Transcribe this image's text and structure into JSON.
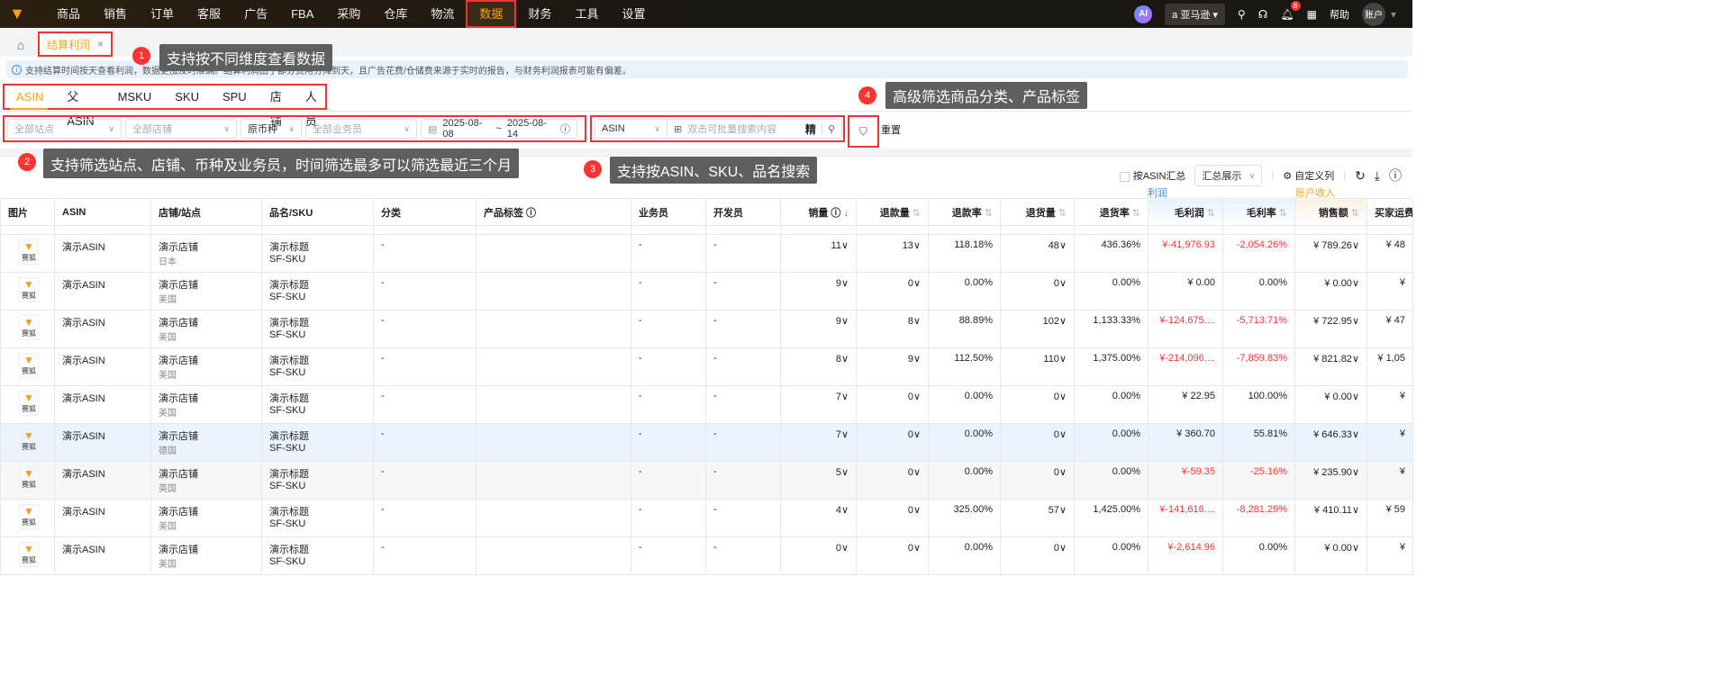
{
  "nav": {
    "items": [
      "商品",
      "销售",
      "订单",
      "客服",
      "广告",
      "FBA",
      "采购",
      "仓库",
      "物流",
      "数据",
      "财务",
      "工具",
      "设置"
    ],
    "active": "数据",
    "ai": "AI",
    "marketplace": "亚马逊",
    "notifications": "8",
    "help": "帮助",
    "account": "账户"
  },
  "page_tab": "结算利润",
  "info": "支持结算时间按天查看利润，数据更加及时准确。结算利润由于部分费用分摊到天，且广告花费/仓储费来源于实时的报告，与财务利润报表可能有偏差。",
  "dim_tabs": [
    "ASIN",
    "父ASIN",
    "MSKU",
    "SKU",
    "SPU",
    "店铺",
    "人员"
  ],
  "filters": {
    "site": "全部站点",
    "store": "全部店铺",
    "currency": "原币种",
    "salesperson": "全部业务员",
    "date_start": "2025-08-08",
    "date_sep": "~",
    "date_end": "2025-08-14",
    "search_type": "ASIN",
    "search_placeholder": "双击可批量搜索内容",
    "exact": "精",
    "reset": "重置"
  },
  "callouts": [
    {
      "num": "1",
      "text": "支持按不同维度查看数据"
    },
    {
      "num": "2",
      "text": "支持筛选站点、店铺、币种及业务员，时间筛选最多可以筛选最近三个月"
    },
    {
      "num": "3",
      "text": "支持按ASIN、SKU、品名搜索"
    },
    {
      "num": "4",
      "text": "高级筛选商品分类、产品标签"
    }
  ],
  "tools": {
    "group_by_asin": "按ASIN汇总",
    "summary_mode": "汇总展示",
    "custom_columns": "自定义列"
  },
  "groups": {
    "profit": "利润",
    "income": "账户收入"
  },
  "columns": [
    "图片",
    "ASIN",
    "店铺/站点",
    "品名/SKU",
    "分类",
    "产品标签",
    "业务员",
    "开发员",
    "销量",
    "退款量",
    "退款率",
    "退货量",
    "退货率",
    "毛利润",
    "毛利率",
    "销售额",
    "买家运费"
  ],
  "thumb_label": "赛狐",
  "rows": [
    [
      "演示ASIN",
      "演示店铺",
      "日本",
      "演示标题",
      "SF-SKU",
      "-",
      "",
      "-",
      "-",
      "11",
      "13",
      "118.18%",
      "48",
      "436.36%",
      "¥-41,976.93",
      "-2,054.26%",
      "¥ 789.26",
      "¥ 48"
    ],
    [
      "演示ASIN",
      "演示店铺",
      "美国",
      "演示标题",
      "SF-SKU",
      "-",
      "",
      "-",
      "-",
      "9",
      "0",
      "0.00%",
      "0",
      "0.00%",
      "¥ 0.00",
      "0.00%",
      "¥ 0.00",
      "¥"
    ],
    [
      "演示ASIN",
      "演示店铺",
      "美国",
      "演示标题",
      "SF-SKU",
      "-",
      "",
      "-",
      "-",
      "9",
      "8",
      "88.89%",
      "102",
      "1,133.33%",
      "¥-124,675....",
      "-5,713.71%",
      "¥ 722.95",
      "¥ 47"
    ],
    [
      "演示ASIN",
      "演示店铺",
      "美国",
      "演示标题",
      "SF-SKU",
      "-",
      "",
      "-",
      "-",
      "8",
      "9",
      "112.50%",
      "110",
      "1,375.00%",
      "¥-214,096....",
      "-7,859.83%",
      "¥ 821.82",
      "¥ 1,05"
    ],
    [
      "演示ASIN",
      "演示店铺",
      "美国",
      "演示标题",
      "SF-SKU",
      "-",
      "",
      "-",
      "-",
      "7",
      "0",
      "0.00%",
      "0",
      "0.00%",
      "¥ 22.95",
      "100.00%",
      "¥ 0.00",
      "¥"
    ],
    [
      "演示ASIN",
      "演示店铺",
      "德国",
      "演示标题",
      "SF-SKU",
      "-",
      "",
      "-",
      "-",
      "7",
      "0",
      "0.00%",
      "0",
      "0.00%",
      "¥ 360.70",
      "55.81%",
      "¥ 646.33",
      "¥"
    ],
    [
      "演示ASIN",
      "演示店铺",
      "英国",
      "演示标题",
      "SF-SKU",
      "-",
      "",
      "-",
      "-",
      "5",
      "0",
      "0.00%",
      "0",
      "0.00%",
      "¥-59.35",
      "-25.16%",
      "¥ 235.90",
      "¥"
    ],
    [
      "演示ASIN",
      "演示店铺",
      "美国",
      "演示标题",
      "SF-SKU",
      "-",
      "",
      "-",
      "-",
      "4",
      "0",
      "325.00%",
      "57",
      "1,425.00%",
      "¥-141,616....",
      "-8,281.29%",
      "¥ 410.11",
      "¥ 59"
    ],
    [
      "演示ASIN",
      "演示店铺",
      "美国",
      "演示标题",
      "SF-SKU",
      "-",
      "",
      "-",
      "-",
      "0",
      "0",
      "0.00%",
      "0",
      "0.00%",
      "¥-2,614.96",
      "0.00%",
      "¥ 0.00",
      "¥"
    ]
  ]
}
